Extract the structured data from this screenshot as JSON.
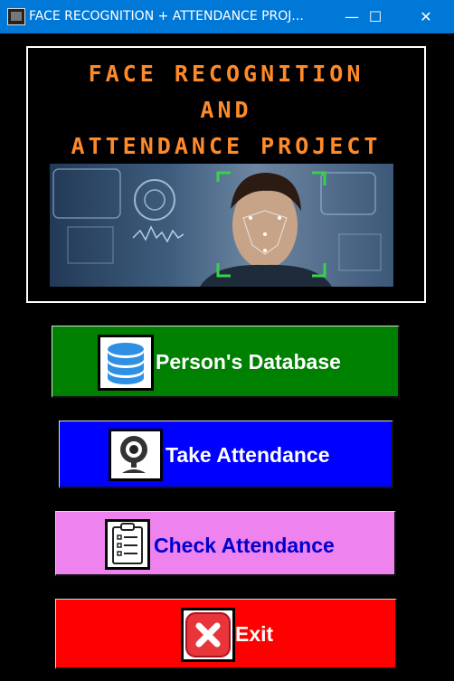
{
  "window": {
    "title": "FACE RECOGNITION + ATTENDANCE PROJ...",
    "minimize_glyph": "—",
    "maximize_glyph": "☐",
    "close_glyph": "✕"
  },
  "banner": {
    "line1": "FACE RECOGNITION",
    "line2": "AND",
    "line3": "ATTENDANCE PROJECT",
    "text_color": "#ff8a2a"
  },
  "buttons": {
    "database": {
      "label": "Person's Database",
      "icon": "database-icon",
      "color": "#008000"
    },
    "take_attendance": {
      "label": "Take Attendance",
      "icon": "webcam-icon",
      "color": "#0000ff"
    },
    "check_attendance": {
      "label": "Check Attendance",
      "icon": "clipboard-icon",
      "color": "#ee82ee"
    },
    "exit": {
      "label": "Exit",
      "icon": "close-x-icon",
      "color": "#ff0000"
    }
  }
}
